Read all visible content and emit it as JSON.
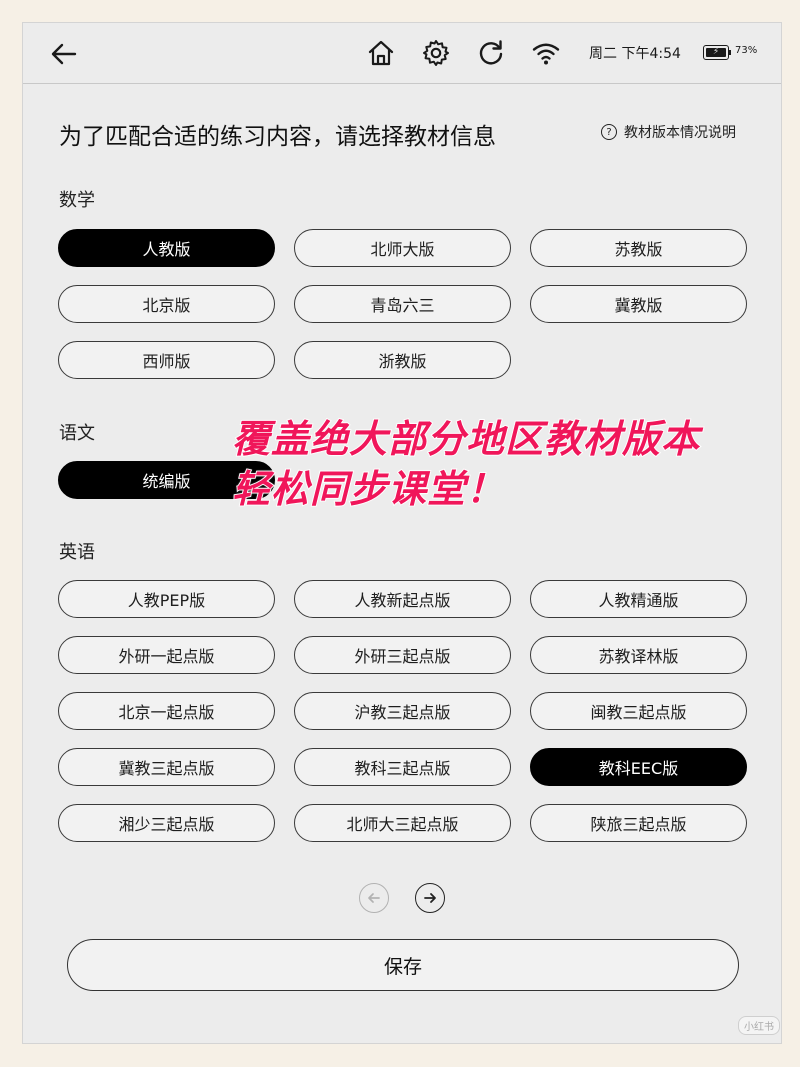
{
  "status_bar": {
    "back_icon": "arrow-left-icon",
    "icons": [
      "home-icon",
      "gear-icon",
      "refresh-icon",
      "wifi-icon"
    ],
    "time": "周二 下午4:54",
    "battery_percent": "73%"
  },
  "page": {
    "heading": "为了匹配合适的练习内容，请选择教材信息",
    "help_label": "教材版本情况说明",
    "help_icon": "question-circle-icon"
  },
  "sections": [
    {
      "title": "数学",
      "options": [
        {
          "label": "人教版",
          "selected": true
        },
        {
          "label": "北师大版",
          "selected": false
        },
        {
          "label": "苏教版",
          "selected": false
        },
        {
          "label": "北京版",
          "selected": false
        },
        {
          "label": "青岛六三",
          "selected": false
        },
        {
          "label": "冀教版",
          "selected": false
        },
        {
          "label": "西师版",
          "selected": false
        },
        {
          "label": "浙教版",
          "selected": false
        }
      ]
    },
    {
      "title": "语文",
      "options": [
        {
          "label": "统编版",
          "selected": true
        }
      ]
    },
    {
      "title": "英语",
      "options": [
        {
          "label": "人教PEP版",
          "selected": false
        },
        {
          "label": "人教新起点版",
          "selected": false
        },
        {
          "label": "人教精通版",
          "selected": false
        },
        {
          "label": "外研一起点版",
          "selected": false
        },
        {
          "label": "外研三起点版",
          "selected": false
        },
        {
          "label": "苏教译林版",
          "selected": false
        },
        {
          "label": "北京一起点版",
          "selected": false
        },
        {
          "label": "沪教三起点版",
          "selected": false
        },
        {
          "label": "闽教三起点版",
          "selected": false
        },
        {
          "label": "冀教三起点版",
          "selected": false
        },
        {
          "label": "教科三起点版",
          "selected": false
        },
        {
          "label": "教科EEC版",
          "selected": true
        },
        {
          "label": "湘少三起点版",
          "selected": false
        },
        {
          "label": "北师大三起点版",
          "selected": false
        },
        {
          "label": "陕旅三起点版",
          "selected": false
        }
      ]
    }
  ],
  "pagination": {
    "prev_icon": "arrow-left-circle-icon",
    "next_icon": "arrow-right-circle-icon",
    "prev_enabled": false
  },
  "save_label": "保存",
  "overlay": {
    "line1": "覆盖绝大部分地区教材版本",
    "line2": "轻松同步课堂！",
    "color": "#f0165a"
  },
  "watermark": {
    "badge": "小红书"
  },
  "colors": {
    "selected_bg": "#000000",
    "pill_border": "#3a3a3a",
    "screen_bg": "#ececec"
  }
}
